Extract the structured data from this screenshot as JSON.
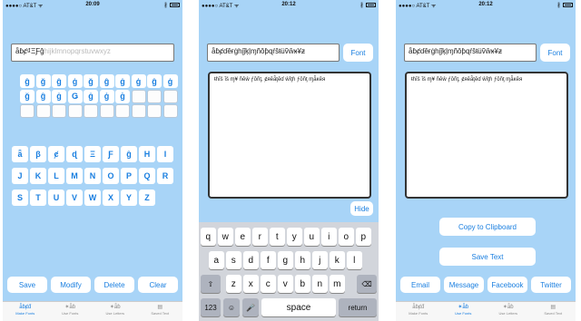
{
  "status": {
    "carrier": "●●●●○ AT&T ᯤ",
    "bt": "∦",
    "times": [
      "20:09",
      "20:12",
      "20:12"
    ]
  },
  "screen1": {
    "input_text": "ǟɓȼ₫ΞƑĝ",
    "input_ghost": "hijklmnopqrstuvwxyz",
    "accent_rows": [
      [
        "ĝ",
        "ǧ",
        "ĝ",
        "ġ",
        "ǧ",
        "ĝ",
        "ġ",
        "ġ",
        "ĝ",
        "ġ"
      ],
      [
        "ğ",
        "ĝ",
        "ġ",
        "Ǥ",
        "ġ",
        "ġ",
        "ģ"
      ]
    ],
    "letter_rows": [
      [
        "ǟ",
        "β",
        "ȼ",
        "ɖ",
        "Ξ",
        "Ƒ",
        "ĝ",
        "H",
        "I"
      ],
      [
        "J",
        "K",
        "L",
        "M",
        "N",
        "O",
        "P",
        "Q",
        "R"
      ],
      [
        "S",
        "T",
        "U",
        "V",
        "W",
        "X",
        "Y",
        "Z"
      ]
    ],
    "buttons": {
      "save": "Save",
      "modify": "Modify",
      "delete": "Delete",
      "clear": "Clear"
    }
  },
  "screen2": {
    "input_text": "ǟɓȼɗêғġhįĵķļɱñǒƥɋŕšŧüṽŵӿ¥ƶ",
    "font_button": "Font",
    "editor_text": "ŧɦĭš ĭš ɱ¥ ñĕŵ ƒŏñţ, ȼяĕǟţĕɗ ŵĭţɦ ƒŏñţ ɱǟĸĕя",
    "hide_button": "Hide",
    "keyboard": {
      "row1": [
        "q",
        "w",
        "e",
        "r",
        "t",
        "y",
        "u",
        "i",
        "o",
        "p"
      ],
      "row2": [
        "a",
        "s",
        "d",
        "f",
        "g",
        "h",
        "j",
        "k",
        "l"
      ],
      "row3": [
        "z",
        "x",
        "c",
        "v",
        "b",
        "n",
        "m"
      ],
      "shift": "⇧",
      "backspace": "⌫",
      "numbers": "123",
      "emoji": "☺",
      "mic": "🎤",
      "space": "space",
      "return": "return"
    }
  },
  "screen3": {
    "input_text": "ǟɓȼɗêғġhįĵķļɱñǒƥɋŕšŧüṽŵӿ¥ƶ",
    "font_button": "Font",
    "editor_text": "ŧɦĭš ĭš ɱ¥ ñĕŵ ƒŏñţ, ȼяĕǟţĕɗ ŵĭţɦ ƒŏñţ ɱǟĸĕя",
    "copy_button": "Copy to Clipboard",
    "save_text_button": "Save Text",
    "share": {
      "email": "Email",
      "message": "Message",
      "facebook": "Facebook",
      "twitter": "Twitter"
    }
  },
  "tabs": [
    {
      "icon": "ǟɓȼđ",
      "label": "Make Fonts"
    },
    {
      "icon": "✶ǟɓ",
      "label": "Use Fonts"
    },
    {
      "icon": "✶ǟɓ",
      "label": "Use Letters"
    },
    {
      "icon": "▤",
      "label": "Saved Text"
    }
  ],
  "active_tabs": [
    0,
    1,
    1
  ],
  "colors": {
    "background": "#a8d4f7",
    "accent": "#1a7fe0"
  }
}
